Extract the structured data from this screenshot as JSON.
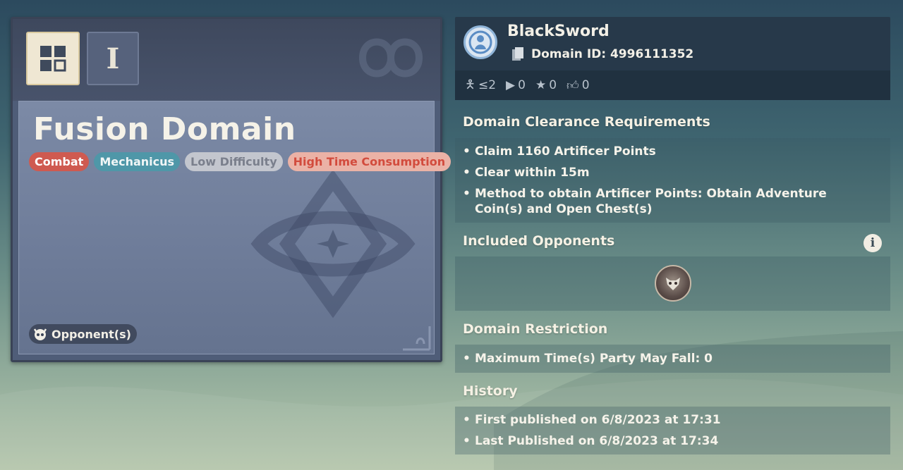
{
  "domain_card": {
    "mode_active_icon": "grid-icon",
    "mode_inactive_label": "I",
    "title": "Fusion Domain",
    "tags": [
      "Combat",
      "Mechanicus",
      "Low Difficulty",
      "High Time Consumption"
    ],
    "opponents_label": "Opponent(s)"
  },
  "profile": {
    "username": "BlackSword",
    "domain_id": "Domain ID: 4996111352",
    "stats": {
      "party_size": "≤2",
      "plays": "0",
      "stars": "0",
      "likes": "0"
    }
  },
  "sections": {
    "clearance": {
      "title": "Domain Clearance Requirements",
      "items": [
        "Claim 1160 Artificer Points",
        "Clear within 15m",
        "Method to obtain Artificer Points: Obtain Adventure Coin(s) and Open Chest(s)"
      ]
    },
    "opponents": {
      "title": "Included Opponents"
    },
    "restriction": {
      "title": "Domain Restriction",
      "items": [
        "Maximum Time(s) Party May Fall: 0"
      ]
    },
    "history": {
      "title": "History",
      "items": [
        "First published on 6/8/2023 at 17:31",
        "Last Published on 6/8/2023 at 17:34"
      ]
    }
  },
  "colors": {
    "combat": "#cf5a50",
    "mechanicus": "#4f97a8",
    "low_difficulty": "#c3c6ce",
    "high_time": "#ebb2a6"
  }
}
